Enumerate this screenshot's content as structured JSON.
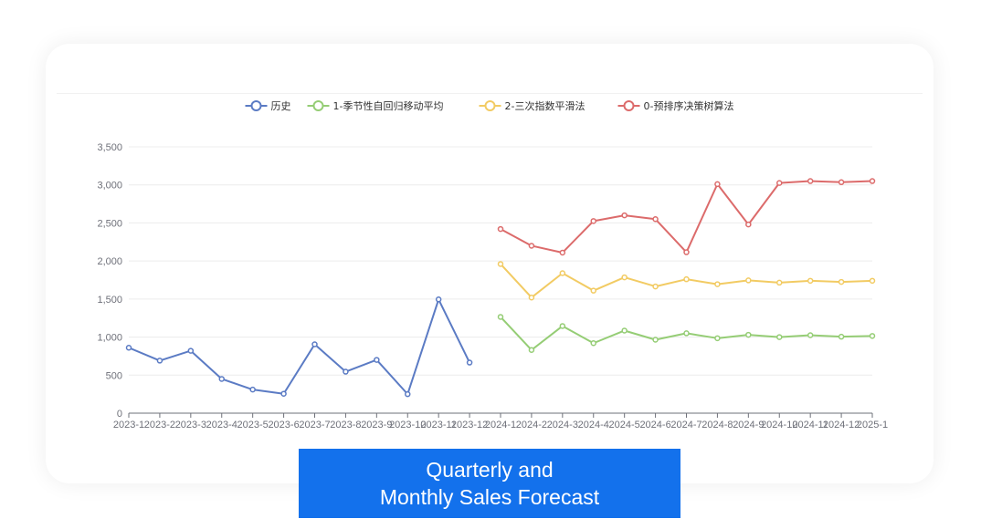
{
  "chart_data": {
    "type": "line",
    "x": [
      "2023-1",
      "2023-2",
      "2023-3",
      "2023-4",
      "2023-5",
      "2023-6",
      "2023-7",
      "2023-8",
      "2023-9",
      "2023-10",
      "2023-11",
      "2023-12",
      "2024-1",
      "2024-2",
      "2024-3",
      "2024-4",
      "2024-5",
      "2024-6",
      "2024-7",
      "2024-8",
      "2024-9",
      "2024-10",
      "2024-11",
      "2024-12",
      "2025-1"
    ],
    "x_tick_labels": [
      "2023-1",
      "2023-2",
      "2023-3",
      "2023-4",
      "2023-5",
      "2023-6",
      "2023-7",
      "2023-8",
      "2023-9",
      "2023-10",
      "2023-11",
      "2023-12",
      "2024-1",
      "2024-2",
      "2024-3",
      "2024-4",
      "2024-5",
      "2024-6",
      "2024-7",
      "2024-8",
      "2024-9",
      "2024-10",
      "2024-11",
      "2024-12",
      "2025-1"
    ],
    "y_tick_labels": [
      "0",
      "500",
      "1,000",
      "1,500",
      "2,000",
      "2,500",
      "3,000",
      "3,500"
    ],
    "ylim": [
      0,
      3500
    ],
    "y_ticks": [
      0,
      500,
      1000,
      1500,
      2000,
      2500,
      3000,
      3500
    ],
    "grid": true,
    "legend_position": "top",
    "series": [
      {
        "name": "历史",
        "color": "#5b7bc4",
        "values": [
          860,
          690,
          820,
          450,
          310,
          255,
          905,
          545,
          700,
          250,
          1495,
          665,
          null,
          null,
          null,
          null,
          null,
          null,
          null,
          null,
          null,
          null,
          null,
          null,
          null
        ]
      },
      {
        "name": "1-季节性自回归移动平均",
        "color": "#95cd75",
        "values": [
          null,
          null,
          null,
          null,
          null,
          null,
          null,
          null,
          null,
          null,
          null,
          null,
          1265,
          830,
          1145,
          920,
          1085,
          965,
          1050,
          985,
          1030,
          1000,
          1025,
          1005,
          1015
        ]
      },
      {
        "name": "2-三次指数平滑法",
        "color": "#f2cb63",
        "values": [
          null,
          null,
          null,
          null,
          null,
          null,
          null,
          null,
          null,
          null,
          null,
          null,
          1960,
          1520,
          1840,
          1610,
          1785,
          1665,
          1760,
          1695,
          1745,
          1715,
          1740,
          1725,
          1740
        ]
      },
      {
        "name": "0-预排序决策树算法",
        "color": "#dc6b6b",
        "values": [
          null,
          null,
          null,
          null,
          null,
          null,
          null,
          null,
          null,
          null,
          null,
          null,
          2420,
          2200,
          2110,
          2525,
          2600,
          2550,
          2115,
          3010,
          2480,
          3025,
          3050,
          3035,
          3050
        ]
      }
    ]
  },
  "caption": {
    "line1": "Quarterly and",
    "line2": "Monthly Sales Forecast"
  }
}
